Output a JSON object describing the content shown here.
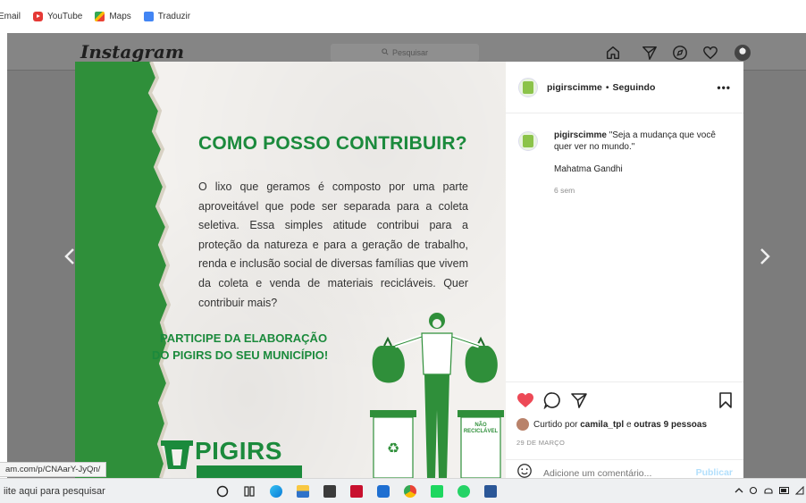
{
  "browser": {
    "bookmarks": [
      {
        "label": "Email",
        "icon": "email-icon"
      },
      {
        "label": "YouTube",
        "icon": "youtube-icon"
      },
      {
        "label": "Maps",
        "icon": "maps-icon"
      },
      {
        "label": "Traduzir",
        "icon": "translate-icon"
      }
    ],
    "status_url": "am.com/p/CNAarY-JyQn/"
  },
  "instagram": {
    "logo": "Instagram",
    "search_placeholder": "Pesquisar",
    "nav_icons": [
      "home-icon",
      "direct-icon",
      "explore-icon",
      "heart-icon",
      "profile-avatar"
    ]
  },
  "post_image": {
    "heading": "COMO POSSO CONTRIBUIR?",
    "body": "O lixo que geramos é composto por uma parte aproveitável que pode ser separada para a coleta seletiva. Essa simples atitude contribui para a proteção da natureza e para a geração de trabalho, renda e inclusão social de diversas famílias que vivem da coleta e venda de materiais recicláveis.  Quer contribuir mais?",
    "cta_line1": "PARTICIPE DA ELABORAÇÃO",
    "cta_line2": "DO PIGIRS DO SEU MUNICÍPIO!",
    "bin_label": "NÃO RECICLÁVEL",
    "brand": "PIGIRS",
    "accent_color": "#1b8a3c"
  },
  "panel": {
    "owner": "pigirscimme",
    "separator": "•",
    "follow_state": "Seguindo",
    "more": "•••",
    "caption_user": "pigirscimme",
    "caption_text": "\"Seja a mudança que você quer ver no mundo.\"",
    "caption_author": "Mahatma Gandhi",
    "caption_time": "6 sem",
    "liked_prefix": "Curtido por",
    "liked_user": "camila_tpl",
    "liked_connector": "e",
    "liked_others": "outras 9 pessoas",
    "date": "29 DE MARÇO",
    "comment_placeholder": "Adicione um comentário...",
    "publish": "Publicar"
  },
  "taskbar": {
    "search_text": "iite aqui para pesquisar",
    "apps": [
      "cortana-icon",
      "task-view-icon",
      "edge-icon",
      "file-explorer-icon",
      "store-icon",
      "mcafee-icon",
      "app-q-icon",
      "chrome-icon",
      "spotify-icon",
      "whatsapp-icon",
      "word-icon"
    ]
  }
}
